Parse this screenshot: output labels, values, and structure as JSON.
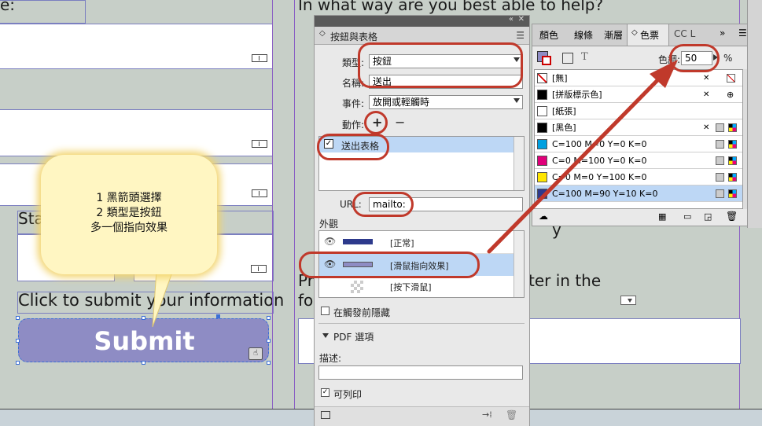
{
  "doc": {
    "partial_label_top": "e:",
    "question_heading": "In what way are you best able to help?",
    "partial_label_state": "Sta",
    "click_submit_text": "Click to submit your information",
    "submit_label": "Submit",
    "prefer_text_line1": "Pr",
    "prefer_text_line2": "fo",
    "prefer_text_right": "ter in the",
    "partial_y": "y"
  },
  "callout": {
    "line1": "1 黑箭頭選擇",
    "line2": "2 類型是按鈕",
    "line3": "多一個指向效果"
  },
  "buttons_panel": {
    "title": "按鈕與表格",
    "type_label": "類型:",
    "type_value": "按鈕",
    "name_label": "名稱:",
    "name_value": "送出",
    "event_label": "事件:",
    "event_value": "放開或輕觸時",
    "actions_label": "動作:",
    "add_symbol": "+",
    "remove_symbol": "−",
    "action_item": "送出表格",
    "url_label": "URL:",
    "url_value": "mailto:",
    "appearance_label": "外觀",
    "states": [
      {
        "label": "[正常]"
      },
      {
        "label": "[滑鼠指向效果]"
      },
      {
        "label": "[按下滑鼠]"
      }
    ],
    "hide_until_triggered_label": "在觸發前隱藏",
    "pdf_options_label": "PDF 選項",
    "description_label": "描述:",
    "printable_label": "可列印"
  },
  "swatches_panel": {
    "tabs": [
      "顏色",
      "線條",
      "漸層",
      "色票",
      "CC L"
    ],
    "active_tab": "色票",
    "tint_label": "色調:",
    "tint_value": "50",
    "tint_unit": "%",
    "rows": [
      {
        "name": "[無]",
        "color": "#ffffff"
      },
      {
        "name": "[拼版標示色]",
        "color": "#000000"
      },
      {
        "name": "[紙張]",
        "color": "#ffffff"
      },
      {
        "name": "[黑色]",
        "color": "#000000"
      },
      {
        "name": "C=100 M=0 Y=0 K=0",
        "color": "#00a0e0"
      },
      {
        "name": "C=0 M=100 Y=0 K=0",
        "color": "#e0007a"
      },
      {
        "name": "C=0 M=0 Y=100 K=0",
        "color": "#ffe600"
      },
      {
        "name": "C=100 M=90 Y=10 K=0",
        "color": "#2d3a8c"
      }
    ]
  },
  "colors": {
    "button_fill": "#8e8cc4",
    "highlight": "#c0392b",
    "selection_blue": "#bdd7f5",
    "callout_fill": "#fff6c2"
  }
}
